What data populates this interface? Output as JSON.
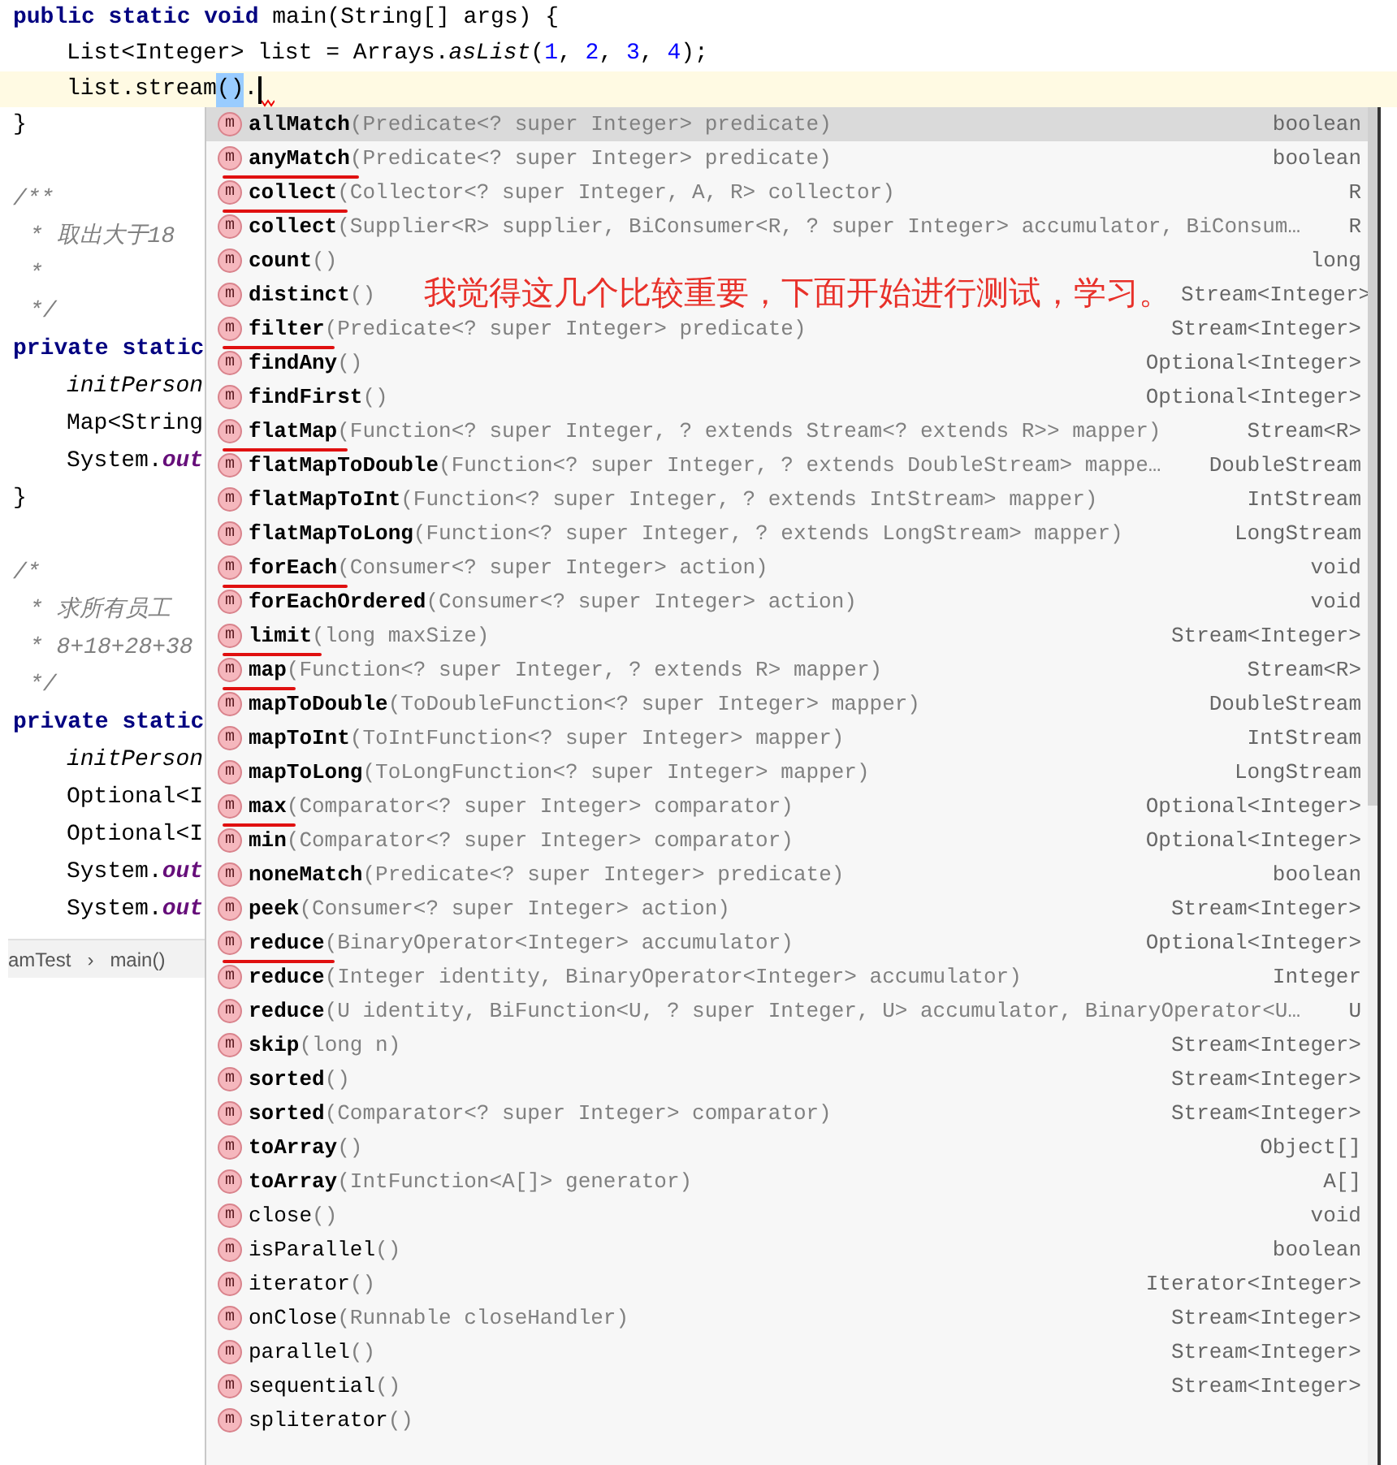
{
  "editor": {
    "lines": [
      {
        "kind": "top",
        "current": false,
        "tokens": [
          {
            "kind": "kw",
            "text": "public static void"
          },
          {
            "kind": "plain",
            "text": " main(String[] args) {"
          }
        ]
      },
      {
        "kind": "body",
        "current": false,
        "tokens": [
          {
            "kind": "plain",
            "text": "List<Integer> list = Arrays."
          },
          {
            "kind": "italic",
            "text": "asList"
          },
          {
            "kind": "plain",
            "text": "("
          },
          {
            "kind": "num",
            "text": "1"
          },
          {
            "kind": "plain",
            "text": ", "
          },
          {
            "kind": "num",
            "text": "2"
          },
          {
            "kind": "plain",
            "text": ", "
          },
          {
            "kind": "num",
            "text": "3"
          },
          {
            "kind": "plain",
            "text": ", "
          },
          {
            "kind": "num",
            "text": "4"
          },
          {
            "kind": "plain",
            "text": ");"
          }
        ]
      },
      {
        "kind": "body",
        "current": true,
        "tokens": [
          {
            "kind": "plain",
            "text": "list.stream"
          },
          {
            "kind": "match",
            "text": "()"
          },
          {
            "kind": "plain",
            "text": "."
          },
          {
            "kind": "caret"
          }
        ]
      }
    ],
    "side_lines": [
      {
        "kind": "top",
        "tokens": [
          {
            "kind": "plain",
            "text": "}"
          }
        ]
      },
      {
        "kind": "top"
      },
      {
        "kind": "top",
        "tokens": [
          {
            "kind": "comment",
            "text": "/**"
          }
        ]
      },
      {
        "kind": "doc",
        "tokens": [
          {
            "kind": "comment",
            "text": "* 取出大于18"
          }
        ]
      },
      {
        "kind": "doc",
        "tokens": [
          {
            "kind": "comment",
            "text": "*"
          }
        ]
      },
      {
        "kind": "doc",
        "tokens": [
          {
            "kind": "comment",
            "text": "*/"
          }
        ]
      },
      {
        "kind": "top",
        "tokens": [
          {
            "kind": "kw",
            "text": "private static"
          }
        ]
      },
      {
        "kind": "body",
        "tokens": [
          {
            "kind": "italic",
            "text": "initPerson"
          }
        ]
      },
      {
        "kind": "body",
        "tokens": [
          {
            "kind": "plain",
            "text": "Map<String"
          }
        ]
      },
      {
        "kind": "body",
        "tokens": [
          {
            "kind": "plain",
            "text": "System."
          },
          {
            "kind": "field",
            "text": "out"
          }
        ]
      },
      {
        "kind": "top",
        "tokens": [
          {
            "kind": "plain",
            "text": "}"
          }
        ]
      },
      {
        "kind": "top"
      },
      {
        "kind": "top",
        "tokens": [
          {
            "kind": "comment",
            "text": "/*"
          }
        ]
      },
      {
        "kind": "doc",
        "tokens": [
          {
            "kind": "comment",
            "text": "* 求所有员工"
          }
        ]
      },
      {
        "kind": "doc",
        "tokens": [
          {
            "kind": "comment",
            "text": "* 8+18+28+38"
          }
        ]
      },
      {
        "kind": "doc",
        "tokens": [
          {
            "kind": "comment",
            "text": "*/"
          }
        ]
      },
      {
        "kind": "top",
        "tokens": [
          {
            "kind": "kw",
            "text": "private static"
          }
        ]
      },
      {
        "kind": "body",
        "tokens": [
          {
            "kind": "italic",
            "text": "initPerson"
          }
        ]
      },
      {
        "kind": "body",
        "tokens": [
          {
            "kind": "plain",
            "text": "Optional<I"
          }
        ]
      },
      {
        "kind": "body",
        "tokens": [
          {
            "kind": "plain",
            "text": "Optional<I"
          }
        ]
      },
      {
        "kind": "body",
        "tokens": [
          {
            "kind": "plain",
            "text": "System."
          },
          {
            "kind": "field",
            "text": "out"
          }
        ]
      },
      {
        "kind": "body",
        "tokens": [
          {
            "kind": "plain",
            "text": "System."
          },
          {
            "kind": "field",
            "text": "out"
          }
        ]
      }
    ]
  },
  "breadcrumb": [
    "amTest",
    "›",
    "main()"
  ],
  "completion": {
    "items": [
      {
        "icon": "m",
        "name": "allMatch",
        "params": "(Predicate<? super Integer> predicate)",
        "type": "boolean",
        "bold": true,
        "selected": true,
        "underlined": false
      },
      {
        "icon": "m",
        "name": "anyMatch",
        "params": "(Predicate<? super Integer> predicate)",
        "type": "boolean",
        "bold": true,
        "selected": false,
        "underlined": true
      },
      {
        "icon": "m",
        "name": "collect",
        "params": "(Collector<? super Integer, A, R> collector)",
        "type": "R",
        "bold": true,
        "selected": false,
        "underlined": true
      },
      {
        "icon": "m",
        "name": "collect",
        "params": "(Supplier<R> supplier, BiConsumer<R, ? super Integer> accumulator, BiConsum…",
        "type": "R",
        "bold": true,
        "selected": false,
        "underlined": false
      },
      {
        "icon": "m",
        "name": "count",
        "params": "()",
        "type": "long",
        "bold": true,
        "selected": false,
        "underlined": false
      },
      {
        "icon": "m",
        "name": "distinct",
        "params": "()",
        "note": "我觉得这几个比较重要，下面开始进行测试，学习。",
        "type": "Stream<Integer>",
        "bold": true,
        "selected": false,
        "underlined": false
      },
      {
        "icon": "m",
        "name": "filter",
        "params": "(Predicate<? super Integer> predicate)",
        "type": "Stream<Integer>",
        "bold": true,
        "selected": false,
        "underlined": true
      },
      {
        "icon": "m",
        "name": "findAny",
        "params": "()",
        "type": "Optional<Integer>",
        "bold": true,
        "selected": false,
        "underlined": false
      },
      {
        "icon": "m",
        "name": "findFirst",
        "params": "()",
        "type": "Optional<Integer>",
        "bold": true,
        "selected": false,
        "underlined": false
      },
      {
        "icon": "m",
        "name": "flatMap",
        "params": "(Function<? super Integer, ? extends Stream<? extends R>> mapper)",
        "type": "Stream<R>",
        "bold": true,
        "selected": false,
        "underlined": true
      },
      {
        "icon": "m",
        "name": "flatMapToDouble",
        "params": "(Function<? super Integer, ? extends DoubleStream> mappe…",
        "type": "DoubleStream",
        "bold": true,
        "selected": false,
        "underlined": false
      },
      {
        "icon": "m",
        "name": "flatMapToInt",
        "params": "(Function<? super Integer, ? extends IntStream> mapper)",
        "type": "IntStream",
        "bold": true,
        "selected": false,
        "underlined": false
      },
      {
        "icon": "m",
        "name": "flatMapToLong",
        "params": "(Function<? super Integer, ? extends LongStream> mapper)",
        "type": "LongStream",
        "bold": true,
        "selected": false,
        "underlined": false
      },
      {
        "icon": "m",
        "name": "forEach",
        "params": "(Consumer<? super Integer> action)",
        "type": "void",
        "bold": true,
        "selected": false,
        "underlined": true
      },
      {
        "icon": "m",
        "name": "forEachOrdered",
        "params": "(Consumer<? super Integer> action)",
        "type": "void",
        "bold": true,
        "selected": false,
        "underlined": false
      },
      {
        "icon": "m",
        "name": "limit",
        "params": "(long maxSize)",
        "type": "Stream<Integer>",
        "bold": true,
        "selected": false,
        "underlined": true
      },
      {
        "icon": "m",
        "name": "map",
        "params": "(Function<? super Integer, ? extends R> mapper)",
        "type": "Stream<R>",
        "bold": true,
        "selected": false,
        "underlined": true
      },
      {
        "icon": "m",
        "name": "mapToDouble",
        "params": "(ToDoubleFunction<? super Integer> mapper)",
        "type": "DoubleStream",
        "bold": true,
        "selected": false,
        "underlined": false
      },
      {
        "icon": "m",
        "name": "mapToInt",
        "params": "(ToIntFunction<? super Integer> mapper)",
        "type": "IntStream",
        "bold": true,
        "selected": false,
        "underlined": false
      },
      {
        "icon": "m",
        "name": "mapToLong",
        "params": "(ToLongFunction<? super Integer> mapper)",
        "type": "LongStream",
        "bold": true,
        "selected": false,
        "underlined": false
      },
      {
        "icon": "m",
        "name": "max",
        "params": "(Comparator<? super Integer> comparator)",
        "type": "Optional<Integer>",
        "bold": true,
        "selected": false,
        "underlined": true
      },
      {
        "icon": "m",
        "name": "min",
        "params": "(Comparator<? super Integer> comparator)",
        "type": "Optional<Integer>",
        "bold": true,
        "selected": false,
        "underlined": false
      },
      {
        "icon": "m",
        "name": "noneMatch",
        "params": "(Predicate<? super Integer> predicate)",
        "type": "boolean",
        "bold": true,
        "selected": false,
        "underlined": false
      },
      {
        "icon": "m",
        "name": "peek",
        "params": "(Consumer<? super Integer> action)",
        "type": "Stream<Integer>",
        "bold": true,
        "selected": false,
        "underlined": false
      },
      {
        "icon": "m",
        "name": "reduce",
        "params": "(BinaryOperator<Integer> accumulator)",
        "type": "Optional<Integer>",
        "bold": true,
        "selected": false,
        "underlined": true
      },
      {
        "icon": "m",
        "name": "reduce",
        "params": "(Integer identity, BinaryOperator<Integer> accumulator)",
        "type": "Integer",
        "bold": true,
        "selected": false,
        "underlined": false
      },
      {
        "icon": "m",
        "name": "reduce",
        "params": "(U identity, BiFunction<U, ? super Integer, U> accumulator, BinaryOperator<U…",
        "type": "U",
        "bold": true,
        "selected": false,
        "underlined": false
      },
      {
        "icon": "m",
        "name": "skip",
        "params": "(long n)",
        "type": "Stream<Integer>",
        "bold": true,
        "selected": false,
        "underlined": false
      },
      {
        "icon": "m",
        "name": "sorted",
        "params": "()",
        "type": "Stream<Integer>",
        "bold": true,
        "selected": false,
        "underlined": false
      },
      {
        "icon": "m",
        "name": "sorted",
        "params": "(Comparator<? super Integer> comparator)",
        "type": "Stream<Integer>",
        "bold": true,
        "selected": false,
        "underlined": false
      },
      {
        "icon": "m",
        "name": "toArray",
        "params": "()",
        "type": "Object[]",
        "bold": true,
        "selected": false,
        "underlined": false
      },
      {
        "icon": "m",
        "name": "toArray",
        "params": "(IntFunction<A[]> generator)",
        "type": "A[]",
        "bold": true,
        "selected": false,
        "underlined": false
      },
      {
        "icon": "m",
        "name": "close",
        "params": "()",
        "type": "void",
        "bold": false,
        "selected": false,
        "underlined": false
      },
      {
        "icon": "m",
        "name": "isParallel",
        "params": "()",
        "type": "boolean",
        "bold": false,
        "selected": false,
        "underlined": false
      },
      {
        "icon": "m",
        "name": "iterator",
        "params": "()",
        "type": "Iterator<Integer>",
        "bold": false,
        "selected": false,
        "underlined": false
      },
      {
        "icon": "m",
        "name": "onClose",
        "params": "(Runnable closeHandler)",
        "type": "Stream<Integer>",
        "bold": false,
        "selected": false,
        "underlined": false
      },
      {
        "icon": "m",
        "name": "parallel",
        "params": "()",
        "type": "Stream<Integer>",
        "bold": false,
        "selected": false,
        "underlined": false
      },
      {
        "icon": "m",
        "name": "sequential",
        "params": "()",
        "type": "Stream<Integer>",
        "bold": false,
        "selected": false,
        "underlined": false
      },
      {
        "icon": "m",
        "name": "spliterator",
        "params": "()",
        "bold": false,
        "selected": false,
        "underlined": false
      }
    ]
  }
}
